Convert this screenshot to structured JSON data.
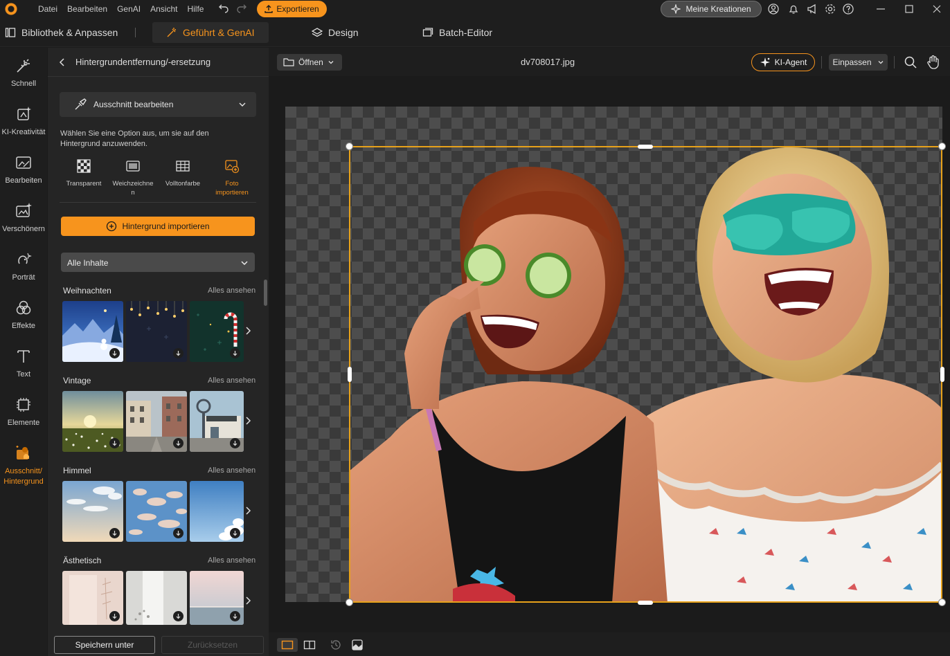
{
  "menu": [
    "Datei",
    "Bearbeiten",
    "GenAI",
    "Ansicht",
    "Hilfe"
  ],
  "export_label": "Exportieren",
  "creations_label": "Meine Kreationen",
  "modes": {
    "library": "Bibliothek & Anpassen",
    "guided": "Geführt & GenAI",
    "design": "Design",
    "batch": "Batch-Editor"
  },
  "rail": [
    {
      "label": "Schnell",
      "icon": "magic-wand-icon"
    },
    {
      "label": "KI-Kreativität",
      "icon": "ai-creative-icon"
    },
    {
      "label": "Bearbeiten",
      "icon": "edit-photo-icon"
    },
    {
      "label": "Verschönern",
      "icon": "enhance-icon"
    },
    {
      "label": "Porträt",
      "icon": "portrait-icon"
    },
    {
      "label": "Effekte",
      "icon": "effects-icon"
    },
    {
      "label": "Text",
      "icon": "text-icon"
    },
    {
      "label": "Elemente",
      "icon": "elements-icon"
    },
    {
      "label": "Ausschnitt/\nHintergrund",
      "icon": "cutout-icon"
    }
  ],
  "panel": {
    "title": "Hintergrundentfernung/-ersetzung",
    "cutout_button": "Ausschnitt bearbeiten",
    "description": "Wählen Sie eine Option aus, um sie auf den Hintergrund anzuwenden.",
    "options": [
      {
        "label": "Transparent",
        "icon": "checker-icon"
      },
      {
        "label": "Weichzeichnen",
        "icon": "blur-icon"
      },
      {
        "label": "Volltonfarbe",
        "icon": "grid-icon"
      },
      {
        "label": "Foto importieren",
        "icon": "photo-import-icon"
      }
    ],
    "import_button": "Hintergrund importieren",
    "filter_select": "Alle Inhalte",
    "see_all": "Alles ansehen",
    "categories": [
      {
        "title": "Weihnachten"
      },
      {
        "title": "Vintage"
      },
      {
        "title": "Himmel"
      },
      {
        "title": "Ästhetisch"
      }
    ],
    "save_button": "Speichern unter",
    "reset_button": "Zurücksetzen"
  },
  "canvas": {
    "open_button": "Öffnen",
    "filename": "dv708017.jpg",
    "ai_agent": "KI-Agent",
    "fit_select": "Einpassen"
  },
  "colors": {
    "accent": "#f7941d",
    "selection": "#e8a21a",
    "background": "#1b1b1b"
  }
}
